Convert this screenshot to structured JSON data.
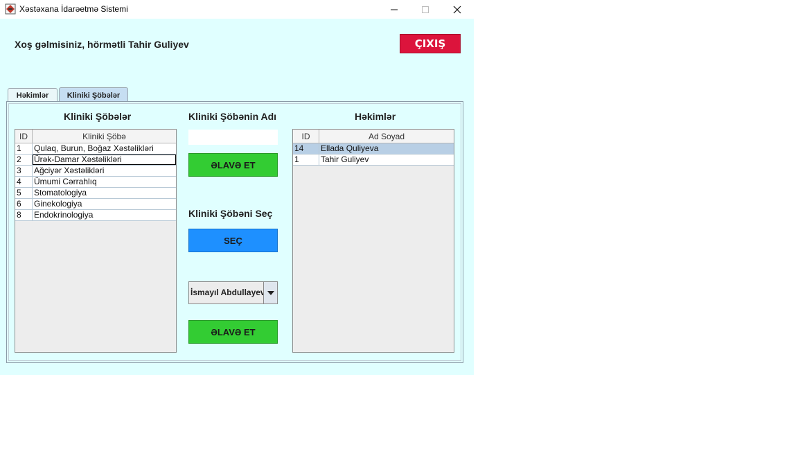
{
  "window": {
    "title": "Xəstəxana İdarəetmə Sistemi"
  },
  "header": {
    "welcome": "Xoş gəlmisiniz, hörmətli Tahir Guliyev",
    "exit_label": "ÇIXIŞ"
  },
  "tabs": [
    {
      "label": "Həkimlər",
      "active": false
    },
    {
      "label": "Kliniki Şöbələr",
      "active": true
    }
  ],
  "departments": {
    "heading": "Kliniki Şöbələr",
    "columns": [
      "ID",
      "Kliniki Şöbə"
    ],
    "rows": [
      [
        "1",
        "Qulaq, Burun, Boğaz Xəstəlikləri"
      ],
      [
        "2",
        "Ürək-Damar Xəstəlikləri"
      ],
      [
        "3",
        "Ağciyər Xəstəlikləri"
      ],
      [
        "4",
        "Ümumi Cərrahlıq"
      ],
      [
        "5",
        "Stomatologiya"
      ],
      [
        "6",
        "Ginekologiya"
      ],
      [
        "8",
        "Endokrinologiya"
      ]
    ]
  },
  "form": {
    "name_heading": "Kliniki Şöbənin Adı",
    "name_value": "",
    "add_label": "ƏLAVƏ ET",
    "select_heading": "Kliniki Şöbəni Seç",
    "select_label": "SEÇ",
    "doctor_selected": "İsmayıl Abdullayev",
    "add2_label": "ƏLAVƏ ET"
  },
  "doctors": {
    "heading": "Həkimlər",
    "columns": [
      "ID",
      "Ad Soyad"
    ],
    "rows": [
      [
        "14",
        "Ellada Quliyeva"
      ],
      [
        "1",
        "Tahir Guliyev"
      ]
    ]
  },
  "colors": {
    "background": "#e0ffff",
    "exit": "#dc143c",
    "green": "#33cc33",
    "blue": "#1e90ff",
    "selected_row": "#b8cfe5"
  }
}
